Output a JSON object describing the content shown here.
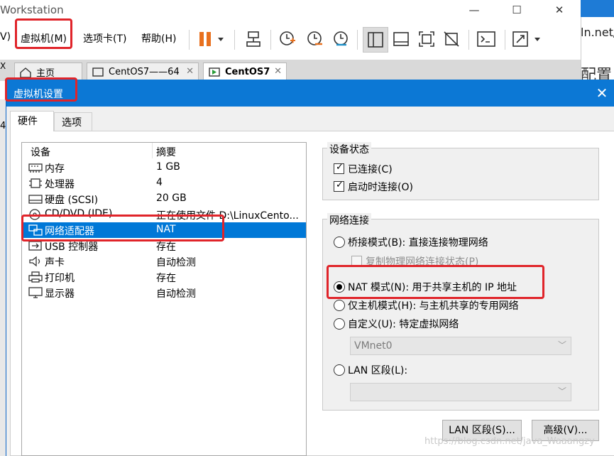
{
  "vmware": {
    "window_title": "Workstation",
    "menus": [
      "V)",
      "虚拟机(M)",
      "选项卡(T)",
      "帮助(H)"
    ],
    "tabs": [
      "主页",
      "CentOS7——64",
      "CentOS7"
    ],
    "edge_url": "ln.net/",
    "edge_label": "配置",
    "left_glyphs": [
      "X",
      "4"
    ]
  },
  "dialog": {
    "title": "虚拟机设置",
    "tabs": [
      "硬件",
      "选项"
    ],
    "device_list": {
      "col_device": "设备",
      "col_summary": "摘要",
      "rows": [
        {
          "name": "内存",
          "summary": "1 GB",
          "icon": "memory-icon"
        },
        {
          "name": "处理器",
          "summary": "4",
          "icon": "processor-icon"
        },
        {
          "name": "硬盘 (SCSI)",
          "summary": "20 GB",
          "icon": "hard-disk-icon"
        },
        {
          "name": "CD/DVD (IDE)",
          "summary": "正在使用文件 D:\\LinuxCento...",
          "icon": "cd-dvd-icon"
        },
        {
          "name": "网络适配器",
          "summary": "NAT",
          "icon": "network-adapter-icon"
        },
        {
          "name": "USB 控制器",
          "summary": "存在",
          "icon": "usb-icon"
        },
        {
          "name": "声卡",
          "summary": "自动检测",
          "icon": "speaker-icon"
        },
        {
          "name": "打印机",
          "summary": "存在",
          "icon": "printer-icon"
        },
        {
          "name": "显示器",
          "summary": "自动检测",
          "icon": "monitor-icon"
        }
      ],
      "selected_index": 4
    },
    "device_status": {
      "title": "设备状态",
      "connected": "已连接(C)",
      "connect_at_power_on": "启动时连接(O)"
    },
    "network": {
      "title": "网络连接",
      "bridged": "桥接模式(B): 直接连接物理网络",
      "replicate": "复制物理网络连接状态(P)",
      "nat": "NAT 模式(N): 用于共享主机的 IP 地址",
      "host_only": "仅主机模式(H): 与主机共享的专用网络",
      "custom": "自定义(U): 特定虚拟网络",
      "custom_value": "VMnet0",
      "lan": "LAN 区段(L):",
      "lan_value": "",
      "selected": "nat"
    },
    "buttons": {
      "lan_segments": "LAN 区段(S)...",
      "advanced": "高级(V)..."
    }
  },
  "watermark": "https://blog.csdn.net/java_Waaangzy",
  "colors": {
    "dialog_title_bg": "#0c78d5",
    "selection": "#0078d7",
    "annotation": "#e0242a",
    "pause_orange": "#e8701e"
  }
}
